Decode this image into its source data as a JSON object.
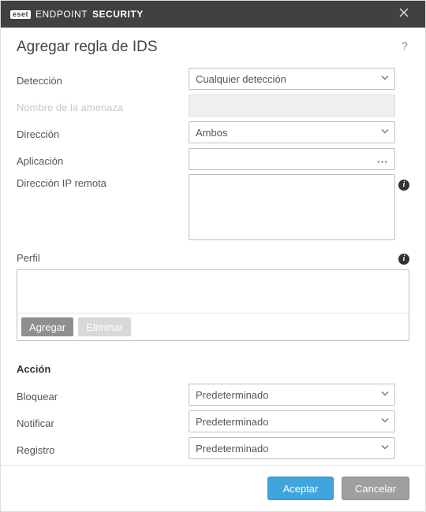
{
  "titlebar": {
    "brand_badge": "eset",
    "brand_ep": "ENDPOINT",
    "brand_sec": "SECURITY"
  },
  "dialog": {
    "title": "Agregar regla de IDS"
  },
  "labels": {
    "detection": "Detección",
    "threat_name": "Nombre de la amenaza",
    "direction": "Dirección",
    "application": "Aplicación",
    "remote_ip": "Dirección IP remota",
    "profile": "Perfil",
    "action_section": "Acción",
    "block": "Bloquear",
    "notify": "Notificar",
    "log": "Registro"
  },
  "values": {
    "detection": "Cualquier detección",
    "threat_name": "",
    "direction": "Ambos",
    "application": "",
    "remote_ip": "",
    "block": "Predeterminado",
    "notify": "Predeterminado",
    "log": "Predeterminado"
  },
  "buttons": {
    "add": "Agregar",
    "delete": "Eliminar",
    "ok": "Aceptar",
    "cancel": "Cancelar"
  }
}
